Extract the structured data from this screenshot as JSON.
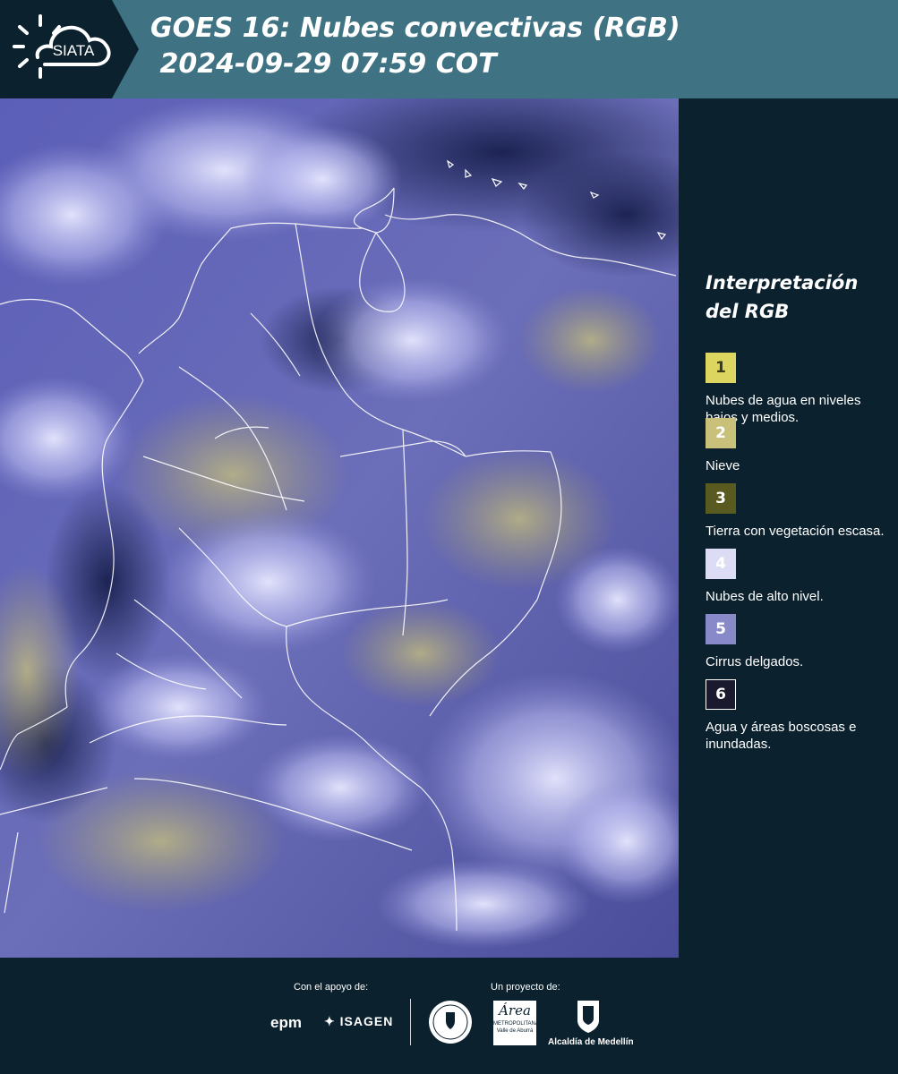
{
  "header": {
    "brand": "SIATA",
    "title_line1": "GOES 16: Nubes convectivas (RGB)",
    "title_line2": " 2024-09-29 07:59 COT"
  },
  "map": {
    "description_icon": "satellite-image-colombia"
  },
  "legend": {
    "title_line1": "Interpretación",
    "title_line2": "del RGB",
    "items": [
      {
        "number": "1",
        "label": "Nubes de agua en niveles bajos y medios.",
        "color": "#dcd55f",
        "text_color": "#3a3a1a"
      },
      {
        "number": "2",
        "label": "Nieve",
        "color": "#c9c079",
        "text_color": "#ffffff"
      },
      {
        "number": "3",
        "label": "Tierra con vegetación escasa.",
        "color": "#595a20",
        "text_color": "#ffffff"
      },
      {
        "number": "4",
        "label": "Nubes de alto nivel.",
        "color": "#dcdcf5",
        "text_color": "#ffffff"
      },
      {
        "number": "5",
        "label": "Cirrus delgados.",
        "color": "#8789c8",
        "text_color": "#ffffff"
      },
      {
        "number": "6",
        "label": "Agua y áreas boscosas e inundadas.",
        "color": "#1a1a2e",
        "text_color": "#ffffff"
      }
    ]
  },
  "footer": {
    "support_label": "Con el apoyo de:",
    "project_label": "Un proyecto de:",
    "epm": "epm",
    "isagen": "ISAGEN",
    "area_name": "Área",
    "area_sub1": "METROPOLITANA",
    "area_sub2": "Valle de Aburrá",
    "alcaldia": "Alcaldía de Medellín"
  }
}
